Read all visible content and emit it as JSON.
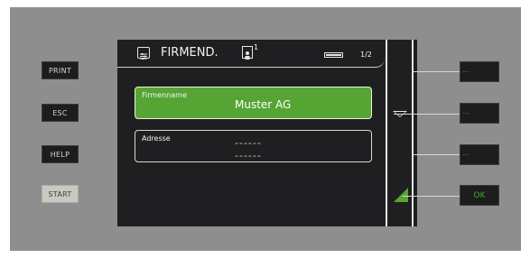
{
  "side_keys": {
    "print": "PRINT",
    "esc": "ESC",
    "help": "HELP",
    "start": "START"
  },
  "screen": {
    "title": "FIRMEND.",
    "person_badge": "1",
    "page_indicator": "1/2",
    "fields": [
      {
        "label": "Firmenname",
        "value": "Muster AG"
      },
      {
        "label": "Adresse",
        "line1": "------",
        "line2": "------"
      }
    ]
  },
  "soft_keys": {
    "ok": "OK"
  },
  "colors": {
    "accent_green": "#56a534",
    "screen_bg": "#1f1f21",
    "frame_bg": "#8e8e8e"
  },
  "icons": [
    "menu-icon",
    "person-icon",
    "battery-icon",
    "arrow-down-icon",
    "green-triangle-icon"
  ]
}
